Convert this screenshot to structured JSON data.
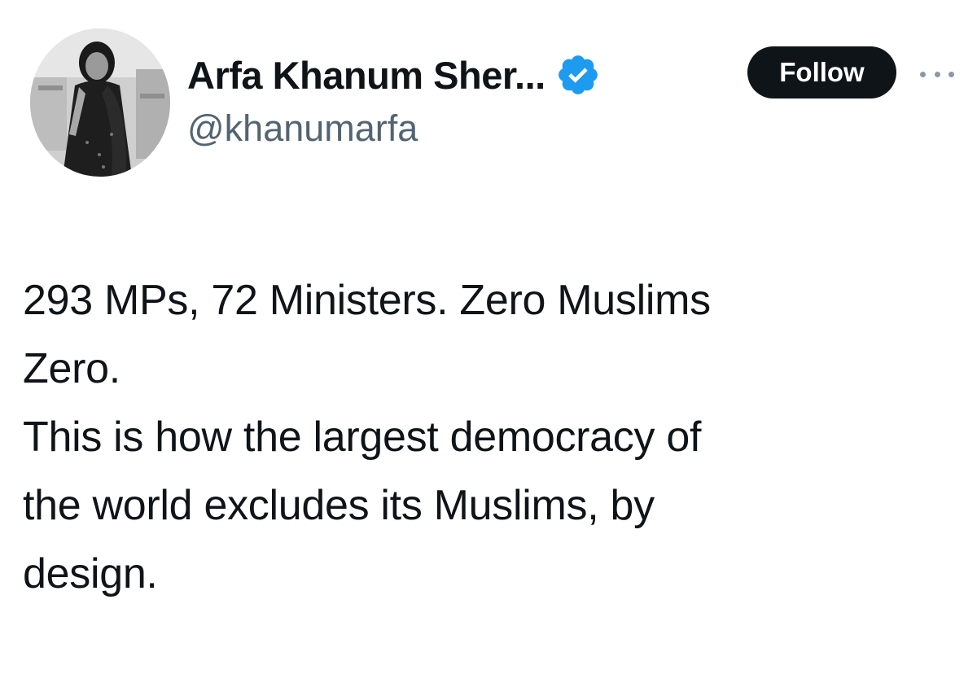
{
  "author": {
    "display_name": "Arfa Khanum Sher...",
    "handle": "@khanumarfa",
    "verified": true,
    "avatar_icon": "profile-photo-avatar"
  },
  "actions": {
    "follow_label": "Follow",
    "more_icon": "more-horizontal-icon"
  },
  "tweet": {
    "lines": [
      "293 MPs, 72 Ministers. Zero Muslims",
      "Zero.",
      "This is how the largest democracy of",
      "the world excludes its Muslims, by",
      "design."
    ]
  },
  "colors": {
    "text_primary": "#0f1419",
    "text_secondary": "#536471",
    "verified_blue": "#1d9bf0",
    "follow_bg": "#0f1419",
    "follow_text": "#ffffff"
  }
}
